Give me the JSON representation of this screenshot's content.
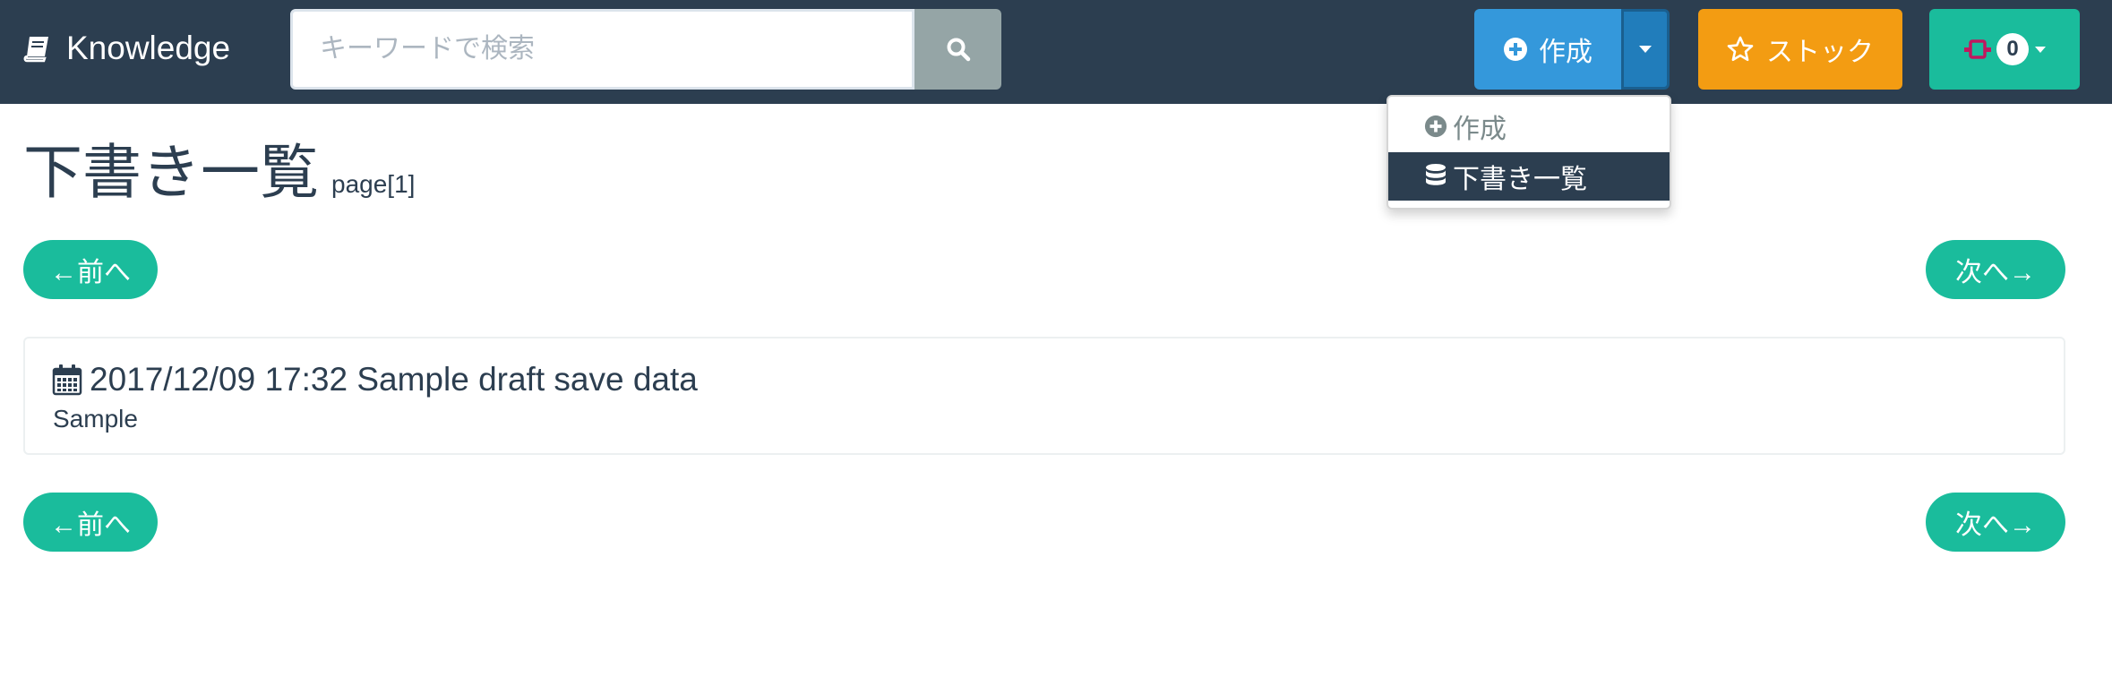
{
  "app": {
    "brand": "Knowledge"
  },
  "search": {
    "placeholder": "キーワードで検索",
    "value": ""
  },
  "nav": {
    "create_label": "作成",
    "stock_label": "ストック",
    "notification_count": "0"
  },
  "create_menu": {
    "items": [
      {
        "label": "作成",
        "icon": "plus-circle-icon"
      },
      {
        "label": "下書き一覧",
        "icon": "database-icon",
        "active": true
      }
    ]
  },
  "page": {
    "title": "下書き一覧",
    "subtitle": "page[1]"
  },
  "pager": {
    "prev_label": "←前へ",
    "next_label": "次へ→"
  },
  "drafts": [
    {
      "title": "2017/12/09 17:32 Sample draft save data",
      "body": "Sample",
      "icon": "calendar-icon"
    }
  ],
  "colors": {
    "navbar": "#2c3e50",
    "primary": "#3498db",
    "warning": "#f39c12",
    "success": "#1abc9c",
    "gray": "#95a5a6"
  }
}
